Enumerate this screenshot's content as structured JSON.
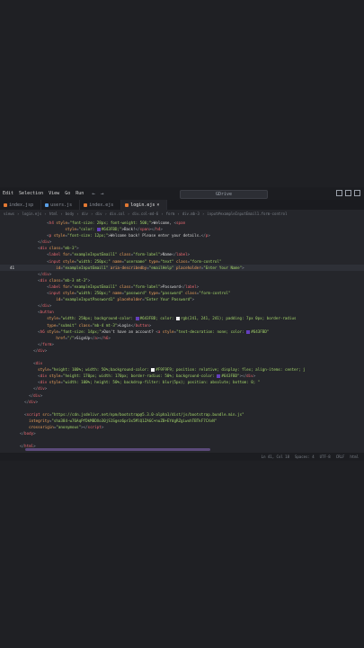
{
  "menubar": {
    "items": [
      "Edit",
      "Selection",
      "View",
      "Go",
      "Run"
    ],
    "nav_back": "←",
    "nav_forward": "→",
    "search_label": "GDrive"
  },
  "tabs": [
    {
      "label": "index.jsp",
      "active": false
    },
    {
      "label": "users.js",
      "active": false
    },
    {
      "label": "index.ejs",
      "active": false
    },
    {
      "label": "login.ejs",
      "active": true
    }
  ],
  "breadcrumb": [
    "views",
    "login.ejs",
    "html",
    "body",
    "div",
    "div",
    "div.col",
    "div.col-md-6",
    "form",
    "div.mb-3",
    "input#exampleInputEmail1.form-control"
  ],
  "code_lines": [
    {
      "n": "",
      "tokens": [
        [
          "pun",
          "            "
        ],
        [
          "pun",
          "<"
        ],
        [
          "tag",
          "h4"
        ],
        [
          "att",
          " style"
        ],
        [
          "pun",
          "="
        ],
        [
          "str",
          "\"font-size: 28px; font-weight: 500;\""
        ],
        [
          "txt",
          ">Welcome, "
        ],
        [
          "pun",
          "<"
        ],
        [
          "tag",
          "span"
        ]
      ]
    },
    {
      "n": "",
      "tokens": [
        [
          "att",
          "                    style"
        ],
        [
          "pun",
          "="
        ],
        [
          "str",
          "\"color: "
        ],
        [
          "sw",
          "#643FBD"
        ],
        [
          "str",
          "#643FBD;\""
        ],
        [
          "txt",
          ">Back!"
        ],
        [
          "pun",
          "</"
        ],
        [
          "tag",
          "span"
        ],
        [
          "pun",
          "></"
        ],
        [
          "tag",
          "h4"
        ],
        [
          "pun",
          ">"
        ]
      ]
    },
    {
      "n": "",
      "tokens": [
        [
          "pun",
          "            <"
        ],
        [
          "tag",
          "p"
        ],
        [
          "att",
          " style"
        ],
        [
          "pun",
          "="
        ],
        [
          "str",
          "\"font-size: 12px;\""
        ],
        [
          "txt",
          ">Welcome back! Please enter your details."
        ],
        [
          "pun",
          "</"
        ],
        [
          "tag",
          "p"
        ],
        [
          "pun",
          ">"
        ]
      ]
    },
    {
      "n": "",
      "tokens": [
        [
          "pun",
          "        </"
        ],
        [
          "tag",
          "div"
        ],
        [
          "pun",
          ">"
        ]
      ]
    },
    {
      "n": "",
      "tokens": [
        [
          "pun",
          "        <"
        ],
        [
          "tag",
          "div"
        ],
        [
          "att",
          " class"
        ],
        [
          "pun",
          "="
        ],
        [
          "str",
          "\"mb-3\""
        ],
        [
          "pun",
          ">"
        ]
      ]
    },
    {
      "n": "",
      "tokens": [
        [
          "pun",
          "            <"
        ],
        [
          "tag",
          "label"
        ],
        [
          "att",
          " for"
        ],
        [
          "pun",
          "="
        ],
        [
          "str",
          "\"exampleInputEmail1\""
        ],
        [
          "att",
          " class"
        ],
        [
          "pun",
          "="
        ],
        [
          "str",
          "\"form-label\""
        ],
        [
          "txt",
          ">Name"
        ],
        [
          "pun",
          "</"
        ],
        [
          "tag",
          "label"
        ],
        [
          "pun",
          ">"
        ]
      ]
    },
    {
      "n": "",
      "tokens": [
        [
          "pun",
          "            <"
        ],
        [
          "tag",
          "input"
        ],
        [
          "att",
          " style"
        ],
        [
          "pun",
          "="
        ],
        [
          "str",
          "\"width: 250px;\""
        ],
        [
          "att",
          " name"
        ],
        [
          "pun",
          "="
        ],
        [
          "str",
          "\"username\""
        ],
        [
          "att",
          " type"
        ],
        [
          "pun",
          "="
        ],
        [
          "str",
          "\"text\""
        ],
        [
          "att",
          " class"
        ],
        [
          "pun",
          "="
        ],
        [
          "str",
          "\"form-control\""
        ]
      ]
    },
    {
      "n": "41",
      "cur": true,
      "tokens": [
        [
          "att",
          "                id"
        ],
        [
          "pun",
          "="
        ],
        [
          "str",
          "\"exampleInputEmail1\""
        ],
        [
          "att",
          " aria-describedby"
        ],
        [
          "pun",
          "="
        ],
        [
          "str",
          "\"emailHelp\""
        ],
        [
          "att",
          " placeholder"
        ],
        [
          "pun",
          "="
        ],
        [
          "str",
          "\"Enter Your Name\""
        ],
        [
          "pun",
          ">"
        ]
      ]
    },
    {
      "n": "",
      "tokens": [
        [
          "pun",
          "        </"
        ],
        [
          "tag",
          "div"
        ],
        [
          "pun",
          ">"
        ]
      ]
    },
    {
      "n": "",
      "tokens": [
        [
          "pun",
          "        <"
        ],
        [
          "tag",
          "div"
        ],
        [
          "att",
          " class"
        ],
        [
          "pun",
          "="
        ],
        [
          "str",
          "\"mb-3 mt-3\""
        ],
        [
          "pun",
          ">"
        ]
      ]
    },
    {
      "n": "",
      "tokens": [
        [
          "pun",
          "            <"
        ],
        [
          "tag",
          "label"
        ],
        [
          "att",
          " for"
        ],
        [
          "pun",
          "="
        ],
        [
          "str",
          "\"exampleInputEmail1\""
        ],
        [
          "att",
          " class"
        ],
        [
          "pun",
          "="
        ],
        [
          "str",
          "\"form-label\""
        ],
        [
          "txt",
          ">Password"
        ],
        [
          "pun",
          "</"
        ],
        [
          "tag",
          "label"
        ],
        [
          "pun",
          ">"
        ]
      ]
    },
    {
      "n": "",
      "tokens": [
        [
          "pun",
          "            <"
        ],
        [
          "tag",
          "input"
        ],
        [
          "att",
          " style"
        ],
        [
          "pun",
          "="
        ],
        [
          "str",
          "\"width: 250px;\""
        ],
        [
          "att",
          " name"
        ],
        [
          "pun",
          "="
        ],
        [
          "str",
          "\"password\""
        ],
        [
          "att",
          " type"
        ],
        [
          "pun",
          "="
        ],
        [
          "str",
          "\"password\""
        ],
        [
          "att",
          " class"
        ],
        [
          "pun",
          "="
        ],
        [
          "str",
          "\"form-control\""
        ]
      ]
    },
    {
      "n": "",
      "tokens": [
        [
          "att",
          "                id"
        ],
        [
          "pun",
          "="
        ],
        [
          "str",
          "\"exampleInputPassword1\""
        ],
        [
          "att",
          " placeholder"
        ],
        [
          "pun",
          "="
        ],
        [
          "str",
          "\"Enter Your Password\""
        ],
        [
          "pun",
          ">"
        ]
      ]
    },
    {
      "n": "",
      "tokens": [
        [
          "pun",
          "        </"
        ],
        [
          "tag",
          "div"
        ],
        [
          "pun",
          ">"
        ]
      ]
    },
    {
      "n": "",
      "tokens": [
        [
          "pun",
          "        <"
        ],
        [
          "tag",
          "button"
        ]
      ]
    },
    {
      "n": "",
      "tokens": [
        [
          "att",
          "            style"
        ],
        [
          "pun",
          "="
        ],
        [
          "str",
          "\"width: 250px; background-color: "
        ],
        [
          "sw",
          "#643FBD"
        ],
        [
          "str",
          "#643FBD; color: "
        ],
        [
          "sw",
          "#f1f1f1"
        ],
        [
          "str",
          "rgb(241, 241, 241); padding: 7px 0px; border-radius"
        ]
      ]
    },
    {
      "n": "",
      "tokens": [
        [
          "att",
          "            type"
        ],
        [
          "pun",
          "="
        ],
        [
          "str",
          "\"submit\""
        ],
        [
          "att",
          " class"
        ],
        [
          "pun",
          "="
        ],
        [
          "str",
          "\"mb-4 mt-3\""
        ],
        [
          "txt",
          ">Login"
        ],
        [
          "pun",
          "</"
        ],
        [
          "tag",
          "button"
        ],
        [
          "pun",
          ">"
        ]
      ]
    },
    {
      "n": "",
      "tokens": [
        [
          "pun",
          "        <"
        ],
        [
          "tag",
          "h6"
        ],
        [
          "att",
          " style"
        ],
        [
          "pun",
          "="
        ],
        [
          "str",
          "\"font-size: 14px;\""
        ],
        [
          "txt",
          ">Don't have an account? "
        ],
        [
          "pun",
          "<"
        ],
        [
          "tag",
          "a"
        ],
        [
          "att",
          " style"
        ],
        [
          "pun",
          "="
        ],
        [
          "str",
          "\"text-decoration: none; color: "
        ],
        [
          "sw",
          "#643FBD"
        ],
        [
          "str",
          "#643FBD\""
        ]
      ]
    },
    {
      "n": "",
      "tokens": [
        [
          "att",
          "                href"
        ],
        [
          "pun",
          "="
        ],
        [
          "str",
          "\"/\""
        ],
        [
          "txt",
          ">SignUp"
        ],
        [
          "pun",
          "</"
        ],
        [
          "tag",
          "a"
        ],
        [
          "pun",
          "></"
        ],
        [
          "tag",
          "h6"
        ],
        [
          "pun",
          ">"
        ]
      ]
    },
    {
      "n": "",
      "tokens": [
        [
          "pun",
          "        </"
        ],
        [
          "tag",
          "form"
        ],
        [
          "pun",
          ">"
        ]
      ]
    },
    {
      "n": "",
      "tokens": [
        [
          "pun",
          "      </"
        ],
        [
          "tag",
          "div"
        ],
        [
          "pun",
          ">"
        ]
      ]
    },
    {
      "n": "",
      "tokens": []
    },
    {
      "n": "",
      "tokens": [
        [
          "pun",
          "      <"
        ],
        [
          "tag",
          "div"
        ]
      ]
    },
    {
      "n": "",
      "tokens": [
        [
          "att",
          "        style"
        ],
        [
          "pun",
          "="
        ],
        [
          "str",
          "\"height: 100%; width: 50%;background-color: "
        ],
        [
          "sw",
          "#F9F9F9"
        ],
        [
          "str",
          "#F9F9F9; position: relative; display: flex; align-items: center; j"
        ]
      ]
    },
    {
      "n": "",
      "tokens": [
        [
          "pun",
          "        <"
        ],
        [
          "tag",
          "div"
        ],
        [
          "att",
          " style"
        ],
        [
          "pun",
          "="
        ],
        [
          "str",
          "\"height: 170px; width: 170px; border-radius: 50%; background-color: "
        ],
        [
          "sw",
          "#643FBD"
        ],
        [
          "str",
          "#643FBD\""
        ],
        [
          "pun",
          "></"
        ],
        [
          "tag",
          "div"
        ],
        [
          "pun",
          ">"
        ]
      ]
    },
    {
      "n": "",
      "tokens": [
        [
          "pun",
          "        <"
        ],
        [
          "tag",
          "div"
        ],
        [
          "att",
          " style"
        ],
        [
          "pun",
          "="
        ],
        [
          "str",
          "\"width: 100%; height: 50%; backdrop-filter: blur(5px); position: absolute; bottom: 0; \""
        ]
      ]
    },
    {
      "n": "",
      "tokens": [
        [
          "pun",
          "      </"
        ],
        [
          "tag",
          "div"
        ],
        [
          "pun",
          ">"
        ]
      ]
    },
    {
      "n": "",
      "tokens": [
        [
          "pun",
          "    </"
        ],
        [
          "tag",
          "div"
        ],
        [
          "pun",
          ">"
        ]
      ]
    },
    {
      "n": "",
      "tokens": [
        [
          "pun",
          "  </"
        ],
        [
          "tag",
          "div"
        ],
        [
          "pun",
          ">"
        ]
      ]
    },
    {
      "n": "",
      "tokens": []
    },
    {
      "n": "",
      "tokens": [
        [
          "pun",
          "  <"
        ],
        [
          "tag",
          "script"
        ],
        [
          "att",
          " src"
        ],
        [
          "pun",
          "="
        ],
        [
          "str",
          "\"https://cdn.jsdelivr.net/npm/bootstrap@5.3.0-alpha1/dist/js/bootstrap.bundle.min.js\""
        ]
      ]
    },
    {
      "n": "",
      "tokens": [
        [
          "att",
          "    integrity"
        ],
        [
          "pun",
          "="
        ],
        [
          "str",
          "\"sha384-w76AqPfDkMBDXo30jS1Sgez6pr3x5MlQ1ZAGC+nuZB+EYdgRZgiwxhTBTkF7CXvN\""
        ]
      ]
    },
    {
      "n": "",
      "tokens": [
        [
          "att",
          "    crossorigin"
        ],
        [
          "pun",
          "="
        ],
        [
          "str",
          "\"anonymous\""
        ],
        [
          "pun",
          "></"
        ],
        [
          "tag",
          "script"
        ],
        [
          "pun",
          ">"
        ]
      ]
    },
    {
      "n": "",
      "tokens": [
        [
          "pun",
          "</"
        ],
        [
          "tag",
          "body"
        ],
        [
          "pun",
          ">"
        ]
      ]
    },
    {
      "n": "",
      "tokens": []
    },
    {
      "n": "",
      "tokens": [
        [
          "pun",
          "</"
        ],
        [
          "tag",
          "html"
        ],
        [
          "pun",
          ">"
        ]
      ]
    }
  ],
  "statusbar": [
    "Ln 41, Col 18",
    "Spaces: 4",
    "UTF-8",
    "CRLF",
    "html"
  ]
}
